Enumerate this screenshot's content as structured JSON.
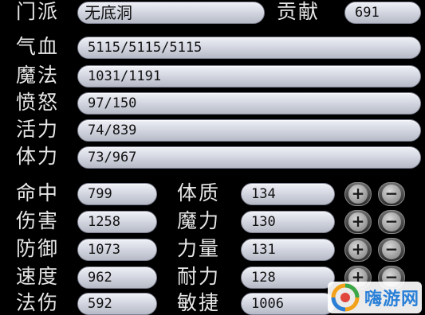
{
  "header": {
    "sect_label": "门派",
    "sect_value": "无底洞",
    "contribution_label": "贡献",
    "contribution_value": "691"
  },
  "vitals": [
    {
      "label": "气血",
      "value": "5115/5115/5115"
    },
    {
      "label": "魔法",
      "value": "1031/1191"
    },
    {
      "label": "愤怒",
      "value": "97/150"
    },
    {
      "label": "活力",
      "value": "74/839"
    },
    {
      "label": "体力",
      "value": "73/967"
    }
  ],
  "combat_stats": [
    {
      "label": "命中",
      "value": "799"
    },
    {
      "label": "伤害",
      "value": "1258"
    },
    {
      "label": "防御",
      "value": "1073"
    },
    {
      "label": "速度",
      "value": "962"
    },
    {
      "label": "法伤",
      "value": "592"
    }
  ],
  "attributes": [
    {
      "label": "体质",
      "value": "134"
    },
    {
      "label": "魔力",
      "value": "130"
    },
    {
      "label": "力量",
      "value": "131"
    },
    {
      "label": "耐力",
      "value": "128"
    },
    {
      "label": "敏捷",
      "value": "1006"
    }
  ],
  "controls": {
    "plus": "+",
    "minus": "−"
  },
  "watermark": {
    "text": "嗨游网",
    "icon": "site-logo-icon"
  },
  "colors": {
    "background": "#000000",
    "label": "#e6e6e6",
    "field": "#d5d8e2"
  }
}
